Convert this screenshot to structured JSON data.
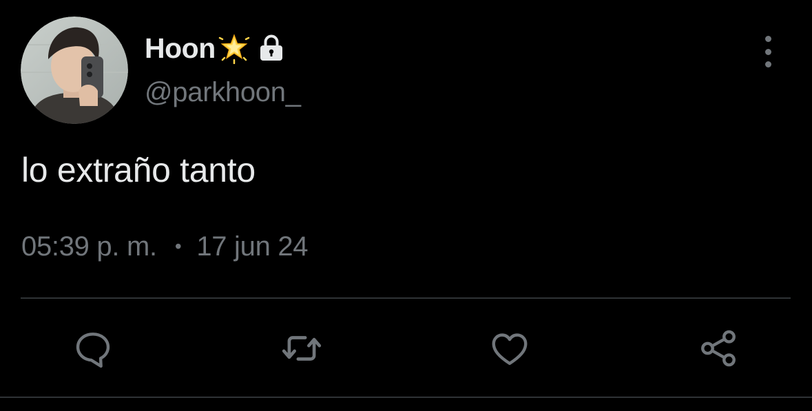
{
  "author": {
    "display_name": "Hoon",
    "badge_icon": "glowing-star-icon",
    "protected_icon": "lock-icon",
    "handle": "@parkhoon_"
  },
  "tweet": {
    "text": "lo extraño tanto",
    "time": "05:39 p. m.",
    "separator": "•",
    "date": "17 jun 24"
  },
  "actions": [
    {
      "name": "reply",
      "icon": "reply-bubble-icon"
    },
    {
      "name": "retweet",
      "icon": "retweet-icon"
    },
    {
      "name": "like",
      "icon": "heart-icon"
    },
    {
      "name": "share",
      "icon": "share-icon"
    }
  ],
  "colors": {
    "background": "#000000",
    "primary_text": "#e7e9ea",
    "secondary_text": "#71767b",
    "divider": "#2f3336",
    "star": "#ffd54a"
  }
}
